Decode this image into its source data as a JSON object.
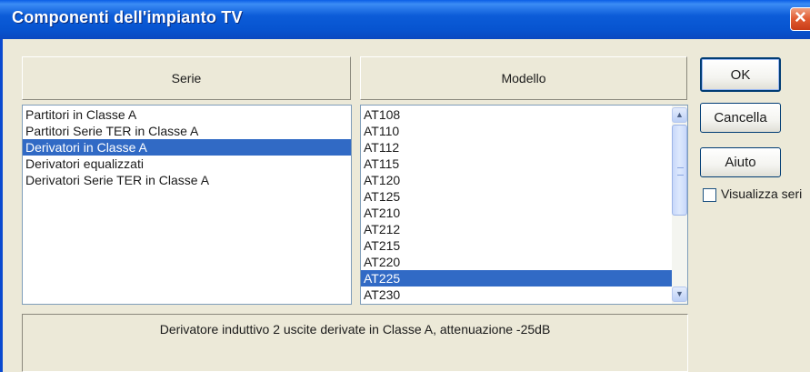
{
  "window": {
    "title": "Componenti dell'impianto TV",
    "close_glyph": "×"
  },
  "headers": {
    "serie": "Serie",
    "modello": "Modello"
  },
  "serie_list": {
    "items": [
      "Partitori in Classe A",
      "Partitori Serie TER in Classe A",
      "Derivatori in Classe A",
      "Derivatori equalizzati",
      "Derivatori Serie TER in Classe A"
    ],
    "selected_index": 2
  },
  "modello_list": {
    "items": [
      "AT108",
      "AT110",
      "AT112",
      "AT115",
      "AT120",
      "AT125",
      "AT210",
      "AT212",
      "AT215",
      "AT220",
      "AT225",
      "AT230"
    ],
    "selected_index": 10
  },
  "buttons": {
    "ok": "OK",
    "cancella": "Cancella",
    "aiuto": "Aiuto"
  },
  "checkbox": {
    "label": "Visualizza seri",
    "checked": false
  },
  "description": "Derivatore induttivo 2 uscite derivate in Classe A, attenuazione -25dB",
  "colors": {
    "selection": "#316ac5",
    "titlebar": "#0754d0",
    "dialog_bg": "#ece9d8"
  },
  "icons": {
    "close": "close-icon",
    "scroll_up": "chevron-up-icon",
    "scroll_down": "chevron-down-icon"
  }
}
